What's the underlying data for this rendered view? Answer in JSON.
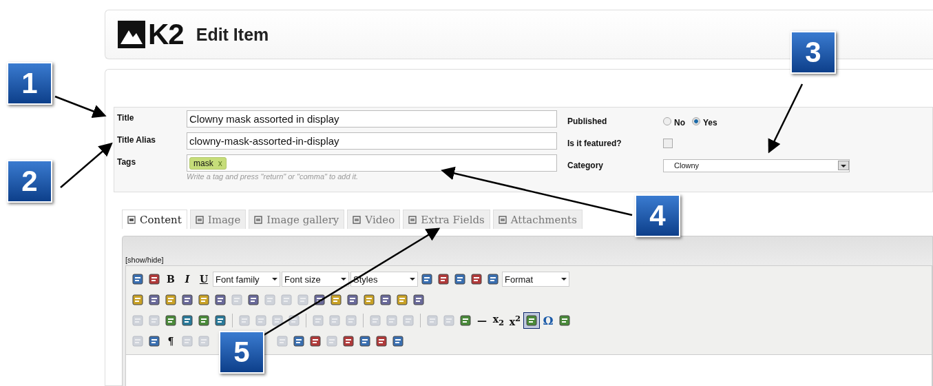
{
  "header": {
    "logo": "K2",
    "title": "Edit Item"
  },
  "form": {
    "title": {
      "label": "Title",
      "value": "Clowny mask assorted in display"
    },
    "alias": {
      "label": "Title Alias",
      "value": "clowny-mask-assorted-in-display"
    },
    "tags": {
      "label": "Tags",
      "items": [
        {
          "text": "mask",
          "remove": "x"
        }
      ],
      "hint": "Write a tag and press \"return\" or \"comma\" to add it."
    },
    "published": {
      "label": "Published",
      "options": [
        {
          "label": "No",
          "selected": false
        },
        {
          "label": "Yes",
          "selected": true
        }
      ]
    },
    "featured": {
      "label": "Is it featured?",
      "checked": false
    },
    "category": {
      "label": "Category",
      "value": "Clowny"
    }
  },
  "tabs": [
    {
      "label": "Content",
      "selected": true
    },
    {
      "label": "Image",
      "selected": false
    },
    {
      "label": "Image gallery",
      "selected": false
    },
    {
      "label": "Video",
      "selected": false
    },
    {
      "label": "Extra Fields",
      "selected": false
    },
    {
      "label": "Attachments",
      "selected": false
    }
  ],
  "editor": {
    "toggle": "[show/hide]",
    "rows": [
      [
        {
          "kind": "icon",
          "disabled": false
        },
        {
          "kind": "icon",
          "disabled": false
        },
        {
          "kind": "glyph",
          "text": "B"
        },
        {
          "kind": "glyph",
          "text": "I"
        },
        {
          "kind": "glyph",
          "text": "U"
        },
        {
          "kind": "select",
          "text": "Font family"
        },
        {
          "kind": "select",
          "text": "Font size"
        },
        {
          "kind": "select",
          "text": "Styles"
        },
        {
          "kind": "icon",
          "disabled": false
        },
        {
          "kind": "icon",
          "disabled": false
        },
        {
          "kind": "icon",
          "disabled": false
        },
        {
          "kind": "icon",
          "disabled": false
        },
        {
          "kind": "icon",
          "disabled": false
        },
        {
          "kind": "select",
          "text": "Format"
        }
      ],
      [
        {
          "kind": "icon",
          "disabled": false
        },
        {
          "kind": "icon",
          "disabled": false
        },
        {
          "kind": "icon",
          "disabled": false
        },
        {
          "kind": "icon",
          "disabled": false
        },
        {
          "kind": "icon",
          "disabled": false
        },
        {
          "kind": "icon",
          "disabled": false
        },
        {
          "kind": "icon",
          "disabled": true
        },
        {
          "kind": "icon",
          "disabled": false
        },
        {
          "kind": "icon",
          "disabled": true
        },
        {
          "kind": "icon",
          "disabled": true
        },
        {
          "kind": "icon",
          "disabled": true
        },
        {
          "kind": "icon",
          "disabled": false
        },
        {
          "kind": "icon",
          "disabled": false
        },
        {
          "kind": "icon",
          "disabled": false
        },
        {
          "kind": "icon",
          "disabled": false
        },
        {
          "kind": "icon",
          "disabled": false
        },
        {
          "kind": "icon",
          "disabled": false
        },
        {
          "kind": "icon",
          "disabled": false
        }
      ],
      [
        {
          "kind": "icon",
          "disabled": true
        },
        {
          "kind": "icon",
          "disabled": true
        },
        {
          "kind": "icon",
          "disabled": false
        },
        {
          "kind": "icon",
          "disabled": false
        },
        {
          "kind": "icon",
          "disabled": false
        },
        {
          "kind": "icon",
          "disabled": false
        },
        {
          "kind": "sep"
        },
        {
          "kind": "icon",
          "disabled": true
        },
        {
          "kind": "icon",
          "disabled": true
        },
        {
          "kind": "icon",
          "disabled": true
        },
        {
          "kind": "icon",
          "disabled": true
        },
        {
          "kind": "sep"
        },
        {
          "kind": "icon",
          "disabled": true
        },
        {
          "kind": "icon",
          "disabled": true
        },
        {
          "kind": "icon",
          "disabled": true
        },
        {
          "kind": "sep"
        },
        {
          "kind": "icon",
          "disabled": true
        },
        {
          "kind": "icon",
          "disabled": true
        },
        {
          "kind": "icon",
          "disabled": true
        },
        {
          "kind": "sep"
        },
        {
          "kind": "icon",
          "disabled": true
        },
        {
          "kind": "icon",
          "disabled": true
        },
        {
          "kind": "icon",
          "disabled": false
        },
        {
          "kind": "glyph",
          "text": "—"
        },
        {
          "kind": "glyph",
          "text": "x$_{2}$"
        },
        {
          "kind": "glyph",
          "text": "x$^{2}$"
        },
        {
          "kind": "icon",
          "disabled": false,
          "selected": true
        },
        {
          "kind": "glyph",
          "text": "Ω"
        },
        {
          "kind": "icon",
          "disabled": false
        }
      ],
      [
        {
          "kind": "icon",
          "disabled": true
        },
        {
          "kind": "icon",
          "disabled": false
        },
        {
          "kind": "glyph",
          "text": "¶"
        },
        {
          "kind": "icon",
          "disabled": true
        },
        {
          "kind": "icon",
          "disabled": true
        },
        {
          "kind": "gap"
        },
        {
          "kind": "icon",
          "disabled": true
        },
        {
          "kind": "icon",
          "disabled": false
        },
        {
          "kind": "icon",
          "disabled": false
        },
        {
          "kind": "icon",
          "disabled": true
        },
        {
          "kind": "icon",
          "disabled": false
        },
        {
          "kind": "icon",
          "disabled": false
        },
        {
          "kind": "icon",
          "disabled": false
        },
        {
          "kind": "icon",
          "disabled": false
        }
      ]
    ]
  },
  "callouts": [
    "1",
    "2",
    "3",
    "4",
    "5"
  ]
}
